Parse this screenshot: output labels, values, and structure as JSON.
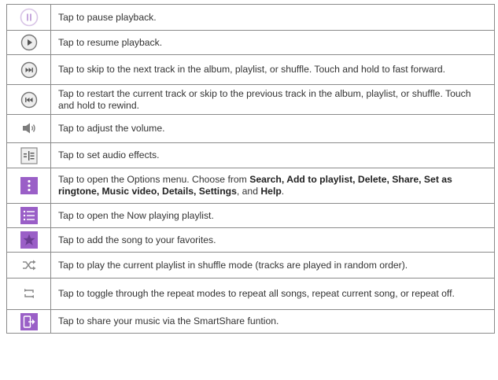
{
  "colors": {
    "purple": "#9a5fc7",
    "pause_ring": "#d8c4e6",
    "circle_button_border": "#777777",
    "gray_icon": "#8a8a8a",
    "border": "#8a8a8a"
  },
  "rows": [
    {
      "icon": "pause-icon",
      "text": "Tap to pause playback."
    },
    {
      "icon": "play-icon",
      "text": "Tap to resume playback."
    },
    {
      "icon": "next-track-icon",
      "text": "Tap to skip to the next track in the album, playlist, or shuffle. Touch and hold to fast forward."
    },
    {
      "icon": "previous-track-icon",
      "text": "Tap to restart the current track or skip to the previous track in the album, playlist, or shuffle. Touch and hold to rewind."
    },
    {
      "icon": "volume-icon",
      "text": "Tap to adjust the volume."
    },
    {
      "icon": "audio-effects-icon",
      "text": "Tap to set audio effects."
    },
    {
      "icon": "options-menu-icon",
      "text_prefix": "Tap to open the Options menu. Choose from ",
      "text_bold": "Search, Add to playlist, Delete, Share, Set as ringtone, Music video, Details, Settings",
      "text_mid": ", and ",
      "text_bold2": "Help",
      "text_suffix": "."
    },
    {
      "icon": "now-playing-list-icon",
      "text": "Tap to open the Now playing playlist."
    },
    {
      "icon": "favorite-star-icon",
      "text": "Tap to add the song to your favorites."
    },
    {
      "icon": "shuffle-icon",
      "text": "Tap to play the current playlist in shuffle mode (tracks are played in random order)."
    },
    {
      "icon": "repeat-icon",
      "text": "Tap to toggle through the repeat modes to repeat all songs, repeat current song, or repeat off."
    },
    {
      "icon": "smartshare-icon",
      "text": "Tap to share your music via the SmartShare funtion."
    }
  ]
}
